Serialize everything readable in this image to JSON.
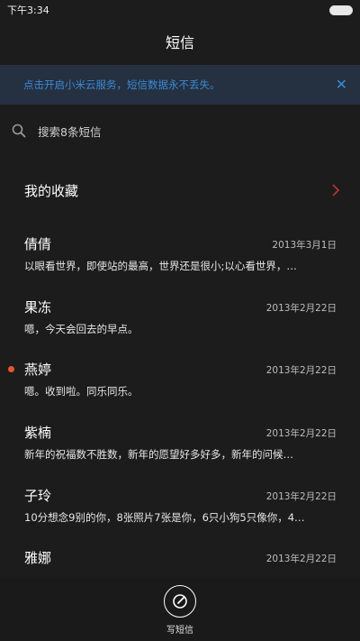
{
  "status_bar": {
    "time": "下午3:34"
  },
  "header": {
    "title": "短信"
  },
  "banner": {
    "text": "点击开启小米云服务，短信数据永不丢失。",
    "close_label": "✕"
  },
  "search": {
    "label": "搜索8条短信"
  },
  "favorites": {
    "label": "我的收藏"
  },
  "messages": [
    {
      "name": "倩倩",
      "date": "2013年3月1日",
      "preview": "以眼看世界，即使站的最高，世界还是很小;以心看世界，…",
      "unread": false
    },
    {
      "name": "果冻",
      "date": "2013年2月22日",
      "preview": "嗯，今天会回去的早点。",
      "unread": false
    },
    {
      "name": "燕婷",
      "date": "2013年2月22日",
      "preview": "嗯。收到啦。同乐同乐。",
      "unread": true
    },
    {
      "name": "紫楠",
      "date": "2013年2月22日",
      "preview": "新年的祝福数不胜数，新年的愿望好多好多，新年的问候…",
      "unread": false
    },
    {
      "name": "子玲",
      "date": "2013年2月22日",
      "preview": "10分想念9别的你，8张照片7张是你，6只小狗5只像你，4…",
      "unread": false
    },
    {
      "name": "雅娜",
      "date": "2013年2月22日",
      "preview": "",
      "unread": false
    }
  ],
  "compose": {
    "label": "写短信"
  },
  "colors": {
    "accent": "#3a8ad6",
    "unread_dot": "#e8562a",
    "fav_arrow": "#b8312f"
  }
}
